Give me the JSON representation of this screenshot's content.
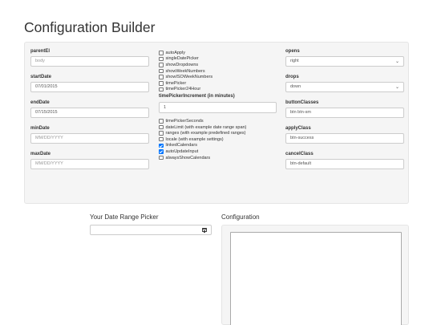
{
  "page_title": "Configuration Builder",
  "col1": {
    "parentEl": {
      "label": "parentEl",
      "value": "body"
    },
    "startDate": {
      "label": "startDate",
      "value": "07/01/2015"
    },
    "endDate": {
      "label": "endDate",
      "value": "07/15/2015"
    },
    "minDate": {
      "label": "minDate",
      "placeholder": "MM/DD/YYYY"
    },
    "maxDate": {
      "label": "maxDate",
      "placeholder": "MM/DD/YYYY"
    }
  },
  "col2": {
    "checkboxes_top": [
      {
        "label": "autoApply",
        "checked": false
      },
      {
        "label": "singleDatePicker",
        "checked": false
      },
      {
        "label": "showDropdowns",
        "checked": false
      },
      {
        "label": "showWeekNumbers",
        "checked": false
      },
      {
        "label": "showISOWeekNumbers",
        "checked": false
      },
      {
        "label": "timePicker",
        "checked": false
      },
      {
        "label": "timePicker24Hour",
        "checked": false
      }
    ],
    "timePickerIncrement": {
      "label": "timePickerIncrement (in minutes)",
      "value": "1"
    },
    "checkboxes_bottom": [
      {
        "label": "timePickerSeconds",
        "checked": false
      },
      {
        "label": "dateLimit (with example date range span)",
        "checked": false
      },
      {
        "label": "ranges (with example predefined ranges)",
        "checked": false
      },
      {
        "label": "locale (with example settings)",
        "checked": false
      },
      {
        "label": "linkedCalendars",
        "checked": true
      },
      {
        "label": "autoUpdateInput",
        "checked": true
      },
      {
        "label": "alwaysShowCalendars",
        "checked": false
      }
    ]
  },
  "col3": {
    "opens": {
      "label": "opens",
      "value": "right"
    },
    "drops": {
      "label": "drops",
      "value": "down"
    },
    "buttonClasses": {
      "label": "buttonClasses",
      "value": "btn btn-sm"
    },
    "applyClass": {
      "label": "applyClass",
      "value": "btn-success"
    },
    "cancelClass": {
      "label": "cancelClass",
      "value": "btn-default"
    }
  },
  "picker": {
    "title": "Your Date Range Picker",
    "value": ""
  },
  "config": {
    "title": "Configuration",
    "content": ""
  },
  "icons": {
    "calendar": "calendar-icon",
    "select_arrow": "chevron-down-icon"
  },
  "colors": {
    "checkbox_checked": "#0075ff",
    "panel_bg": "#f5f5f5"
  }
}
